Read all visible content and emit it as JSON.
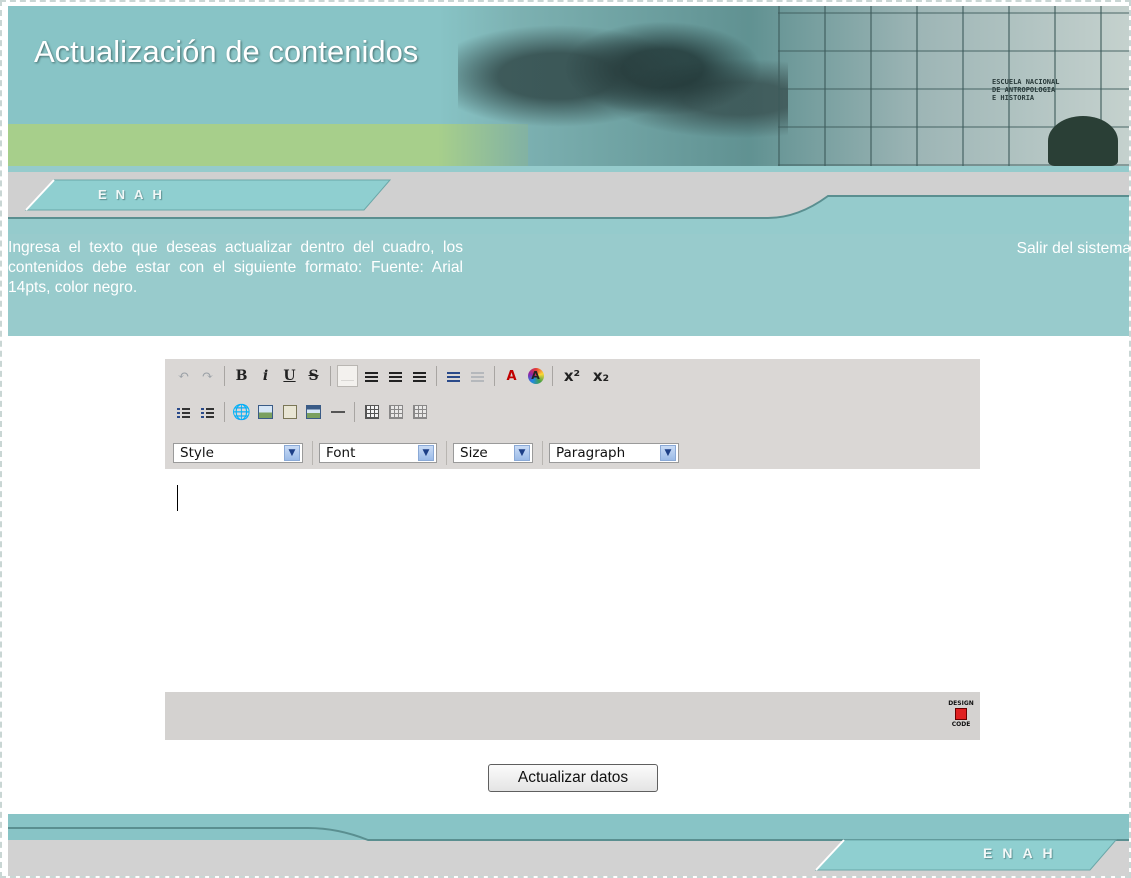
{
  "header": {
    "title": "Actualización de contenidos",
    "sign_text": [
      "ESCUELA NACIONAL",
      "DE ANTROPOLOGIA",
      "E HISTORIA"
    ]
  },
  "nav": {
    "top_tab_label": "ENAH",
    "bottom_tab_label": "ENAH"
  },
  "info": {
    "instruction": "Ingresa el texto que deseas actualizar dentro del cuadro, los contenidos debe estar con el siguiente formato: Fuente: Arial 14pts, color negro.",
    "logout_link": "Salir del sistema"
  },
  "editor": {
    "dropdowns": {
      "style": "Style",
      "font": "Font",
      "size": "Size",
      "paragraph": "Paragraph"
    },
    "toolbar_glyphs": {
      "bold": "B",
      "italic": "i",
      "underline": "U",
      "strike": "S",
      "forecolor": "A",
      "superscript": "x²",
      "subscript": "x₂"
    },
    "content": "",
    "logo_lines": [
      "DESIGN",
      "CODE"
    ]
  },
  "form": {
    "submit_label": "Actualizar datos"
  },
  "colors": {
    "teal": "#88c4c6",
    "grey": "#d0d0d0",
    "toolbar": "#dad7d5"
  }
}
